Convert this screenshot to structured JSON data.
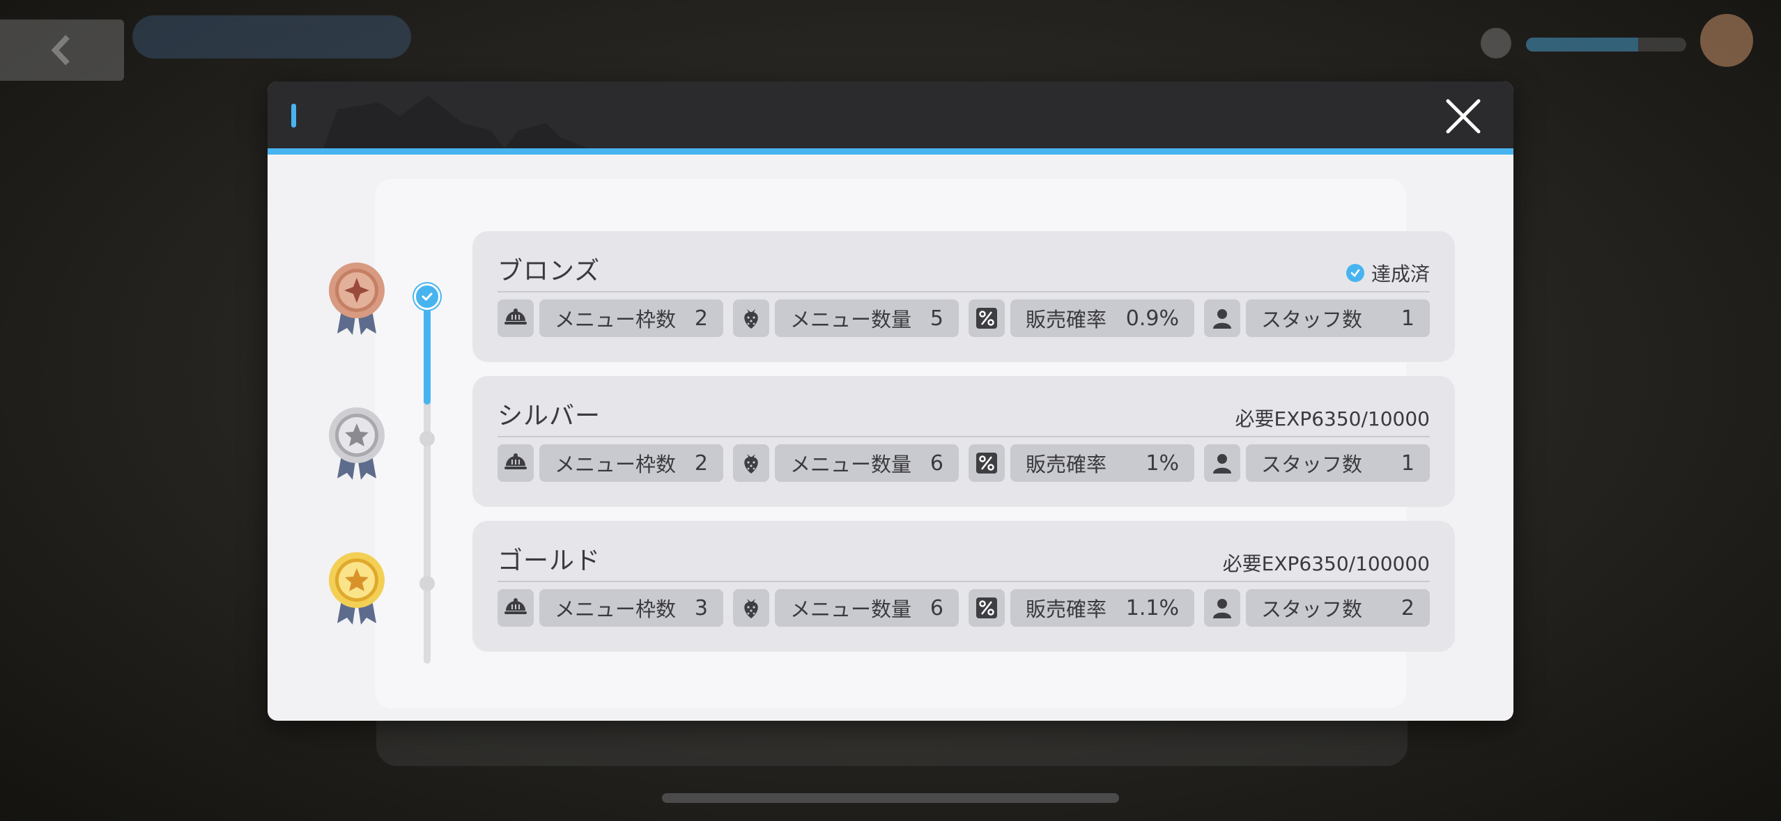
{
  "dialog": {
    "close_label": "×"
  },
  "ranks": [
    {
      "name": "ブロンズ",
      "status": "達成済",
      "achieved": true,
      "medal": "bronze-medal-icon",
      "stats": {
        "menu_slots_label": "メニュー枠数",
        "menu_slots": "2",
        "menu_count_label": "メニュー数量",
        "menu_count": "5",
        "sales_rate_label": "販売確率",
        "sales_rate": "0.9%",
        "staff_label": "スタッフ数",
        "staff": "1"
      }
    },
    {
      "name": "シルバー",
      "status": "必要EXP6350/10000",
      "achieved": false,
      "medal": "silver-medal-icon",
      "stats": {
        "menu_slots_label": "メニュー枠数",
        "menu_slots": "2",
        "menu_count_label": "メニュー数量",
        "menu_count": "6",
        "sales_rate_label": "販売確率",
        "sales_rate": "1%",
        "staff_label": "スタッフ数",
        "staff": "1"
      }
    },
    {
      "name": "ゴールド",
      "status": "必要EXP6350/100000",
      "achieved": false,
      "medal": "gold-medal-icon",
      "stats": {
        "menu_slots_label": "メニュー枠数",
        "menu_slots": "3",
        "menu_count_label": "メニュー数量",
        "menu_count": "6",
        "sales_rate_label": "販売確率",
        "sales_rate": "1.1%",
        "staff_label": "スタッフ数",
        "staff": "2"
      }
    }
  ],
  "icons": {
    "menu_slots": "cloche-icon",
    "menu_count": "strawberry-icon",
    "sales_rate": "percent-icon",
    "staff": "person-icon"
  },
  "colors": {
    "accent": "#48b4ef",
    "header": "#2b2b2d",
    "card": "#e6e6ea",
    "stat_box": "#c9cacf",
    "bronze": "#c98a6e",
    "silver": "#b8b8bc",
    "gold": "#f0c040"
  }
}
